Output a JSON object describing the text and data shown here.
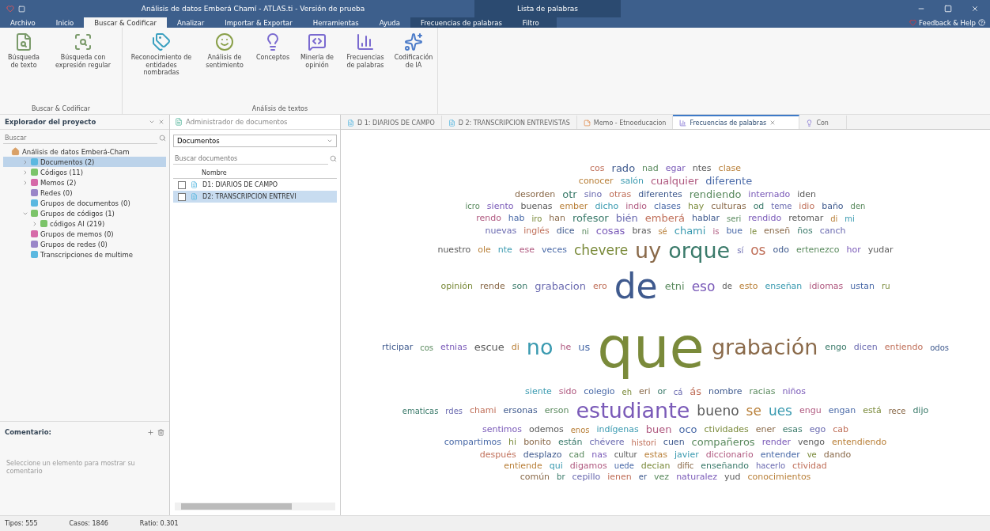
{
  "window": {
    "title": "Análisis de datos Emberá Chamí - ATLAS.ti - Versión de prueba",
    "context_title": "Lista de palabras"
  },
  "menu_tabs": [
    {
      "label": "Archivo",
      "selected": false
    },
    {
      "label": "Inicio",
      "selected": false
    },
    {
      "label": "Buscar & Codificar",
      "selected": true
    },
    {
      "label": "Analizar",
      "selected": false
    },
    {
      "label": "Importar & Exportar",
      "selected": false
    },
    {
      "label": "Herramientas",
      "selected": false
    },
    {
      "label": "Ayuda",
      "selected": false
    }
  ],
  "context_tabs": [
    {
      "label": "Frecuencias de palabras",
      "selected": false
    },
    {
      "label": "Filtro",
      "selected": false
    }
  ],
  "feedback": "Feedback & Help",
  "ribbon_groups": [
    {
      "title": "Buscar & Codificar",
      "buttons": [
        {
          "kind": "search",
          "label": "Búsqueda de texto"
        },
        {
          "kind": "regex",
          "label": "Búsqueda con expresión regular"
        }
      ]
    },
    {
      "title": "Análisis de textos",
      "buttons": [
        {
          "kind": "entities",
          "label": "Reconocimiento de entidades nombradas"
        },
        {
          "kind": "sentiment",
          "label": "Análisis de sentimiento"
        },
        {
          "kind": "concepts",
          "label": "Conceptos"
        },
        {
          "kind": "opinion",
          "label": "Minería de opinión"
        },
        {
          "kind": "frequency",
          "label": "Frecuencias de palabras"
        },
        {
          "kind": "ai",
          "label": "Codificación de IA"
        }
      ]
    }
  ],
  "project_explorer": {
    "title": "Explorador del proyecto",
    "search": {
      "placeholder": "Buscar"
    },
    "tree": {
      "label": "Análisis de datos Emberá-Cham",
      "color": "#d9a066",
      "children": [
        {
          "label": "Documentos (2)",
          "color": "#5bb8e0",
          "expanded": false,
          "selected": true
        },
        {
          "label": "Códigos (11)",
          "color": "#7cc46a",
          "expanded": false,
          "selected": false
        },
        {
          "label": "Memos (2)",
          "color": "#d66aa8",
          "expanded": false,
          "selected": false
        },
        {
          "label": "Redes (0)",
          "color": "#9a86c8",
          "selected": false
        },
        {
          "label": "Grupos de documentos (0)",
          "color": "#5bb8e0",
          "selected": false
        },
        {
          "label": "Grupos de códigos (1)",
          "color": "#7cc46a",
          "expanded": true,
          "selected": false,
          "children": [
            {
              "label": "códigos AI (219)",
              "color": "#7cc46a",
              "expanded": false,
              "selected": false
            }
          ]
        },
        {
          "label": "Grupos de memos (0)",
          "color": "#d66aa8",
          "selected": false
        },
        {
          "label": "Grupos de redes (0)",
          "color": "#9a86c8",
          "selected": false
        },
        {
          "label": "Transcripciones de multime",
          "color": "#5bb8e0",
          "selected": false
        }
      ]
    }
  },
  "comment": {
    "title": "Comentario:",
    "placeholder": "Seleccione un elemento para mostrar su comentario"
  },
  "document_manager": {
    "title": "Administrador de documentos",
    "filter": "Documentos",
    "search": {
      "placeholder": "Buscar documentos"
    },
    "column": "Nombre",
    "rows": [
      {
        "name": "D1: DIARIOS DE CAMPO",
        "checked": false,
        "selected": false
      },
      {
        "name": "D2: TRANSCRIPCION ENTREVI",
        "checked": false,
        "selected": true
      }
    ]
  },
  "doc_tabs": [
    {
      "label": "D 1: DIARIOS DE CAMPO",
      "kind": "document",
      "selected": false
    },
    {
      "label": "D 2: TRANSCRIPCION ENTREVISTAS",
      "kind": "document",
      "selected": false
    },
    {
      "label": "Memo - Etnoeducacion",
      "kind": "memo",
      "selected": false
    },
    {
      "label": "Frecuencias de palabras",
      "kind": "frequency",
      "selected": true
    },
    {
      "label": "Con",
      "kind": "concepts",
      "selected": false
    }
  ],
  "word_cloud": {
    "lines": [
      {
        "words": [
          {
            "text": "cos",
            "kind": "small"
          },
          {
            "text": "rado",
            "kind": "medium"
          },
          {
            "text": "nad",
            "kind": "small"
          },
          {
            "text": "egar",
            "kind": "small"
          },
          {
            "text": "ntes",
            "kind": "small"
          },
          {
            "text": "clase",
            "kind": "small"
          }
        ]
      },
      {
        "words": [
          {
            "text": "conocer",
            "kind": "small"
          },
          {
            "text": "salón",
            "kind": "small"
          },
          {
            "text": "cualquier",
            "kind": "medium"
          },
          {
            "text": "diferente",
            "kind": "medium"
          }
        ]
      },
      {
        "words": [
          {
            "text": "desorden",
            "kind": "small"
          },
          {
            "text": "otr",
            "kind": "medium"
          },
          {
            "text": "sino",
            "kind": "small"
          },
          {
            "text": "otras",
            "kind": "small"
          },
          {
            "text": "diferentes",
            "kind": "small"
          },
          {
            "text": "rendiendo",
            "kind": "medium"
          },
          {
            "text": "internado",
            "kind": "small"
          },
          {
            "text": "iden",
            "kind": "small"
          }
        ]
      },
      {
        "words": [
          {
            "text": "icro",
            "kind": "tiny"
          },
          {
            "text": "siento",
            "kind": "small"
          },
          {
            "text": "buenas",
            "kind": "small"
          },
          {
            "text": "ember",
            "kind": "small"
          },
          {
            "text": "dicho",
            "kind": "small"
          },
          {
            "text": "indio",
            "kind": "small"
          },
          {
            "text": "clases",
            "kind": "small"
          },
          {
            "text": "hay",
            "kind": "small"
          },
          {
            "text": "culturas",
            "kind": "small"
          },
          {
            "text": "od",
            "kind": "small"
          },
          {
            "text": "teme",
            "kind": "tiny"
          },
          {
            "text": "idio",
            "kind": "small"
          },
          {
            "text": "baño",
            "kind": "small"
          },
          {
            "text": "den",
            "kind": "tiny"
          }
        ]
      },
      {
        "words": [
          {
            "text": "rendo",
            "kind": "small"
          },
          {
            "text": "hab",
            "kind": "small"
          },
          {
            "text": "iro",
            "kind": "tiny"
          },
          {
            "text": "han",
            "kind": "small"
          },
          {
            "text": "rofesor",
            "kind": "medium"
          },
          {
            "text": "bién",
            "kind": "medium"
          },
          {
            "text": "emberá",
            "kind": "medium"
          },
          {
            "text": "hablar",
            "kind": "small"
          },
          {
            "text": "seri",
            "kind": "tiny"
          },
          {
            "text": "rendido",
            "kind": "small"
          },
          {
            "text": "retomar",
            "kind": "small"
          },
          {
            "text": "di",
            "kind": "tiny"
          },
          {
            "text": "mi",
            "kind": "tiny"
          }
        ]
      },
      {
        "words": [
          {
            "text": "nuevas",
            "kind": "small"
          },
          {
            "text": "inglés",
            "kind": "small"
          },
          {
            "text": "dice",
            "kind": "small"
          },
          {
            "text": "ni",
            "kind": "tiny"
          },
          {
            "text": "cosas",
            "kind": "medium"
          },
          {
            "text": "bras",
            "kind": "small"
          },
          {
            "text": "sé",
            "kind": "tiny"
          },
          {
            "text": "chami",
            "kind": "medium"
          },
          {
            "text": "is",
            "kind": "tiny"
          },
          {
            "text": "bue",
            "kind": "small"
          },
          {
            "text": "le",
            "kind": "tiny"
          },
          {
            "text": "enseñ",
            "kind": "small"
          },
          {
            "text": "ños",
            "kind": "small"
          },
          {
            "text": "canch",
            "kind": "small"
          }
        ]
      },
      {
        "words": [
          {
            "text": "nuestro",
            "kind": "small"
          },
          {
            "text": "ole",
            "kind": "small"
          },
          {
            "text": "nte",
            "kind": "small"
          },
          {
            "text": "ese",
            "kind": "small"
          },
          {
            "text": "veces",
            "kind": "small"
          },
          {
            "text": "chevere",
            "kind": "large"
          },
          {
            "text": "uy",
            "kind": "big"
          },
          {
            "text": "orque",
            "kind": "big"
          },
          {
            "text": "sí",
            "kind": "tiny"
          },
          {
            "text": "os",
            "kind": "large"
          },
          {
            "text": "odo",
            "kind": "small"
          },
          {
            "text": "ertenezco",
            "kind": "small"
          },
          {
            "text": "hor",
            "kind": "small"
          },
          {
            "text": "yudar",
            "kind": "small"
          }
        ]
      },
      {
        "words": [
          {
            "text": "opinión",
            "kind": "small"
          },
          {
            "text": "rende",
            "kind": "small"
          },
          {
            "text": "son",
            "kind": "small"
          },
          {
            "text": "grabacion",
            "kind": "medium"
          },
          {
            "text": "ero",
            "kind": "small"
          },
          {
            "text": "de",
            "kind": "bigger"
          },
          {
            "text": "etni",
            "kind": "medium"
          },
          {
            "text": "eso",
            "kind": "large"
          },
          {
            "text": "de",
            "kind": "tiny"
          },
          {
            "text": "esto",
            "kind": "small"
          },
          {
            "text": "enseñan",
            "kind": "small"
          },
          {
            "text": "idiomas",
            "kind": "small"
          },
          {
            "text": "ustan",
            "kind": "small"
          },
          {
            "text": "ru",
            "kind": "tiny"
          }
        ]
      },
      {
        "words": [
          {
            "text": "rticipar",
            "kind": "small"
          },
          {
            "text": "cos",
            "kind": "tiny"
          },
          {
            "text": "etnias",
            "kind": "small"
          },
          {
            "text": "escue",
            "kind": "medium"
          },
          {
            "text": "di",
            "kind": "small"
          },
          {
            "text": "no",
            "kind": "big"
          },
          {
            "text": "he",
            "kind": "small"
          },
          {
            "text": "us",
            "kind": "medium"
          },
          {
            "text": "que",
            "kind": "biggest"
          },
          {
            "text": "grabación",
            "kind": "big"
          },
          {
            "text": "engo",
            "kind": "small"
          },
          {
            "text": "dicen",
            "kind": "small"
          },
          {
            "text": "entiendo",
            "kind": "small"
          },
          {
            "text": "odos",
            "kind": "tiny"
          }
        ]
      },
      {
        "words": [
          {
            "text": "siente",
            "kind": "small"
          },
          {
            "text": "sido",
            "kind": "small"
          },
          {
            "text": "colegio",
            "kind": "small"
          },
          {
            "text": "eh",
            "kind": "tiny"
          },
          {
            "text": "eri",
            "kind": "small"
          },
          {
            "text": "or",
            "kind": "small"
          },
          {
            "text": "cá",
            "kind": "tiny"
          },
          {
            "text": "ás",
            "kind": "medium"
          },
          {
            "text": "nombre",
            "kind": "small"
          },
          {
            "text": "racias",
            "kind": "small"
          },
          {
            "text": "niños",
            "kind": "small"
          }
        ]
      },
      {
        "words": [
          {
            "text": "ematicas",
            "kind": "tiny"
          },
          {
            "text": "rdes",
            "kind": "tiny"
          },
          {
            "text": "chami",
            "kind": "small"
          },
          {
            "text": "ersonas",
            "kind": "small"
          },
          {
            "text": "erson",
            "kind": "small"
          },
          {
            "text": "estudiante",
            "kind": "big"
          },
          {
            "text": "bueno",
            "kind": "large"
          },
          {
            "text": "se",
            "kind": "large"
          },
          {
            "text": "ues",
            "kind": "large"
          },
          {
            "text": "engu",
            "kind": "small"
          },
          {
            "text": "engan",
            "kind": "small"
          },
          {
            "text": "está",
            "kind": "small"
          },
          {
            "text": "rece",
            "kind": "tiny"
          },
          {
            "text": "dijo",
            "kind": "small"
          }
        ]
      },
      {
        "words": [
          {
            "text": "sentimos",
            "kind": "small"
          },
          {
            "text": "odemos",
            "kind": "small"
          },
          {
            "text": "enos",
            "kind": "tiny"
          },
          {
            "text": "indígenas",
            "kind": "small"
          },
          {
            "text": "buen",
            "kind": "medium"
          },
          {
            "text": "oco",
            "kind": "medium"
          },
          {
            "text": "ctividades",
            "kind": "small"
          },
          {
            "text": "ener",
            "kind": "small"
          },
          {
            "text": "esas",
            "kind": "small"
          },
          {
            "text": "ego",
            "kind": "small"
          },
          {
            "text": "cab",
            "kind": "small"
          }
        ]
      },
      {
        "words": [
          {
            "text": "compartimos",
            "kind": "small"
          },
          {
            "text": "hi",
            "kind": "small"
          },
          {
            "text": "bonito",
            "kind": "small"
          },
          {
            "text": "están",
            "kind": "small"
          },
          {
            "text": "chévere",
            "kind": "small"
          },
          {
            "text": "histori",
            "kind": "tiny"
          },
          {
            "text": "cuen",
            "kind": "small"
          },
          {
            "text": "compañeros",
            "kind": "medium"
          },
          {
            "text": "render",
            "kind": "small"
          },
          {
            "text": "vengo",
            "kind": "small"
          },
          {
            "text": "entendiendo",
            "kind": "small"
          }
        ]
      },
      {
        "words": [
          {
            "text": "después",
            "kind": "small"
          },
          {
            "text": "desplazo",
            "kind": "small"
          },
          {
            "text": "cad",
            "kind": "small"
          },
          {
            "text": "nas",
            "kind": "small"
          },
          {
            "text": "cultur",
            "kind": "tiny"
          },
          {
            "text": "estas",
            "kind": "small"
          },
          {
            "text": "javier",
            "kind": "small"
          },
          {
            "text": "diccionario",
            "kind": "small"
          },
          {
            "text": "entender",
            "kind": "small"
          },
          {
            "text": "ve",
            "kind": "tiny"
          },
          {
            "text": "dando",
            "kind": "small"
          }
        ]
      },
      {
        "words": [
          {
            "text": "entiende",
            "kind": "small"
          },
          {
            "text": "qui",
            "kind": "small"
          },
          {
            "text": "digamos",
            "kind": "small"
          },
          {
            "text": "uede",
            "kind": "tiny"
          },
          {
            "text": "decian",
            "kind": "small"
          },
          {
            "text": "dific",
            "kind": "tiny"
          },
          {
            "text": "enseñando",
            "kind": "small"
          },
          {
            "text": "hacerlo",
            "kind": "tiny"
          },
          {
            "text": "ctividad",
            "kind": "small"
          }
        ]
      },
      {
        "words": [
          {
            "text": "común",
            "kind": "small"
          },
          {
            "text": "br",
            "kind": "tiny"
          },
          {
            "text": "cepillo",
            "kind": "small"
          },
          {
            "text": "ienen",
            "kind": "small"
          },
          {
            "text": "er",
            "kind": "tiny"
          },
          {
            "text": "vez",
            "kind": "small"
          },
          {
            "text": "naturalez",
            "kind": "small"
          },
          {
            "text": "yud",
            "kind": "small"
          },
          {
            "text": "conocimientos",
            "kind": "small"
          }
        ]
      }
    ]
  },
  "status_bar": [
    {
      "text": "Tipos: 555"
    },
    {
      "text": "Casos: 1846"
    },
    {
      "text": "Ratio: 0.301"
    }
  ]
}
